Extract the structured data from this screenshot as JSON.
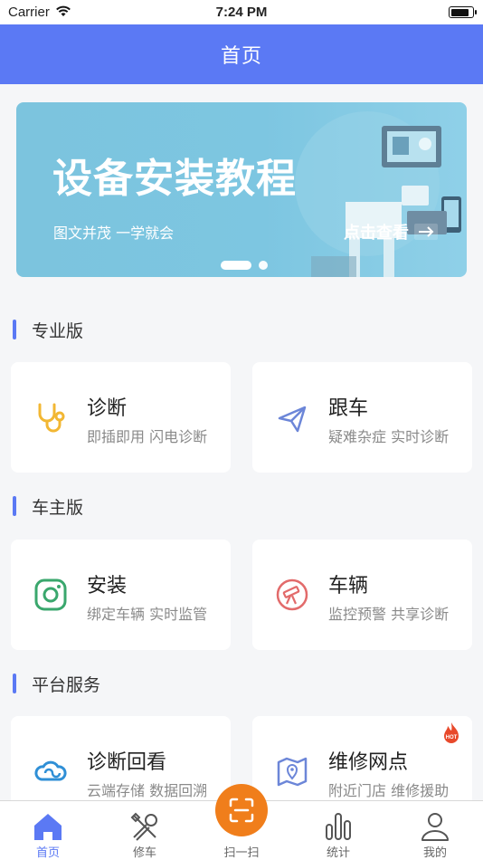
{
  "status_bar": {
    "carrier": "Carrier",
    "time": "7:24 PM",
    "battery_level": 0.85
  },
  "nav": {
    "title": "首页"
  },
  "banner": {
    "title": "设备安装教程",
    "subtitle": "图文并茂  一学就会",
    "cta": "点击查看",
    "active_slide": 1,
    "slide_count": 2
  },
  "sections": [
    {
      "label": "专业版",
      "cards": [
        {
          "title": "诊断",
          "desc": "即插即用 闪电诊断",
          "icon": "stethoscope-icon",
          "color": "#f2b733"
        },
        {
          "title": "跟车",
          "desc": "疑难杂症 实时诊断",
          "icon": "paper-plane-icon",
          "color": "#6c86d8"
        }
      ]
    },
    {
      "label": "车主版",
      "cards": [
        {
          "title": "安装",
          "desc": "绑定车辆 实时监管",
          "icon": "camera-icon",
          "color": "#3aa76d"
        },
        {
          "title": "车辆",
          "desc": "监控预警 共享诊断",
          "icon": "telescope-icon",
          "color": "#e26b6b"
        }
      ]
    },
    {
      "label": "平台服务",
      "cards": [
        {
          "title": "诊断回看",
          "desc": "云端存储 数据回溯",
          "icon": "cloud-icon",
          "color": "#2f8fd6"
        },
        {
          "title": "维修网点",
          "desc": "附近门店 维修援助",
          "icon": "map-pin-icon",
          "color": "#6c86d8",
          "badge": "HOT"
        }
      ]
    }
  ],
  "tabs": [
    {
      "label": "首页",
      "icon": "home-icon",
      "active": true
    },
    {
      "label": "修车",
      "icon": "tools-icon",
      "active": false
    },
    {
      "label": "扫一扫",
      "icon": "scan-icon",
      "active": false
    },
    {
      "label": "统计",
      "icon": "chart-icon",
      "active": false
    },
    {
      "label": "我的",
      "icon": "user-icon",
      "active": false
    }
  ],
  "colors": {
    "primary": "#5b79f4",
    "scan": "#f07e1b",
    "hot": "#e8492b"
  }
}
